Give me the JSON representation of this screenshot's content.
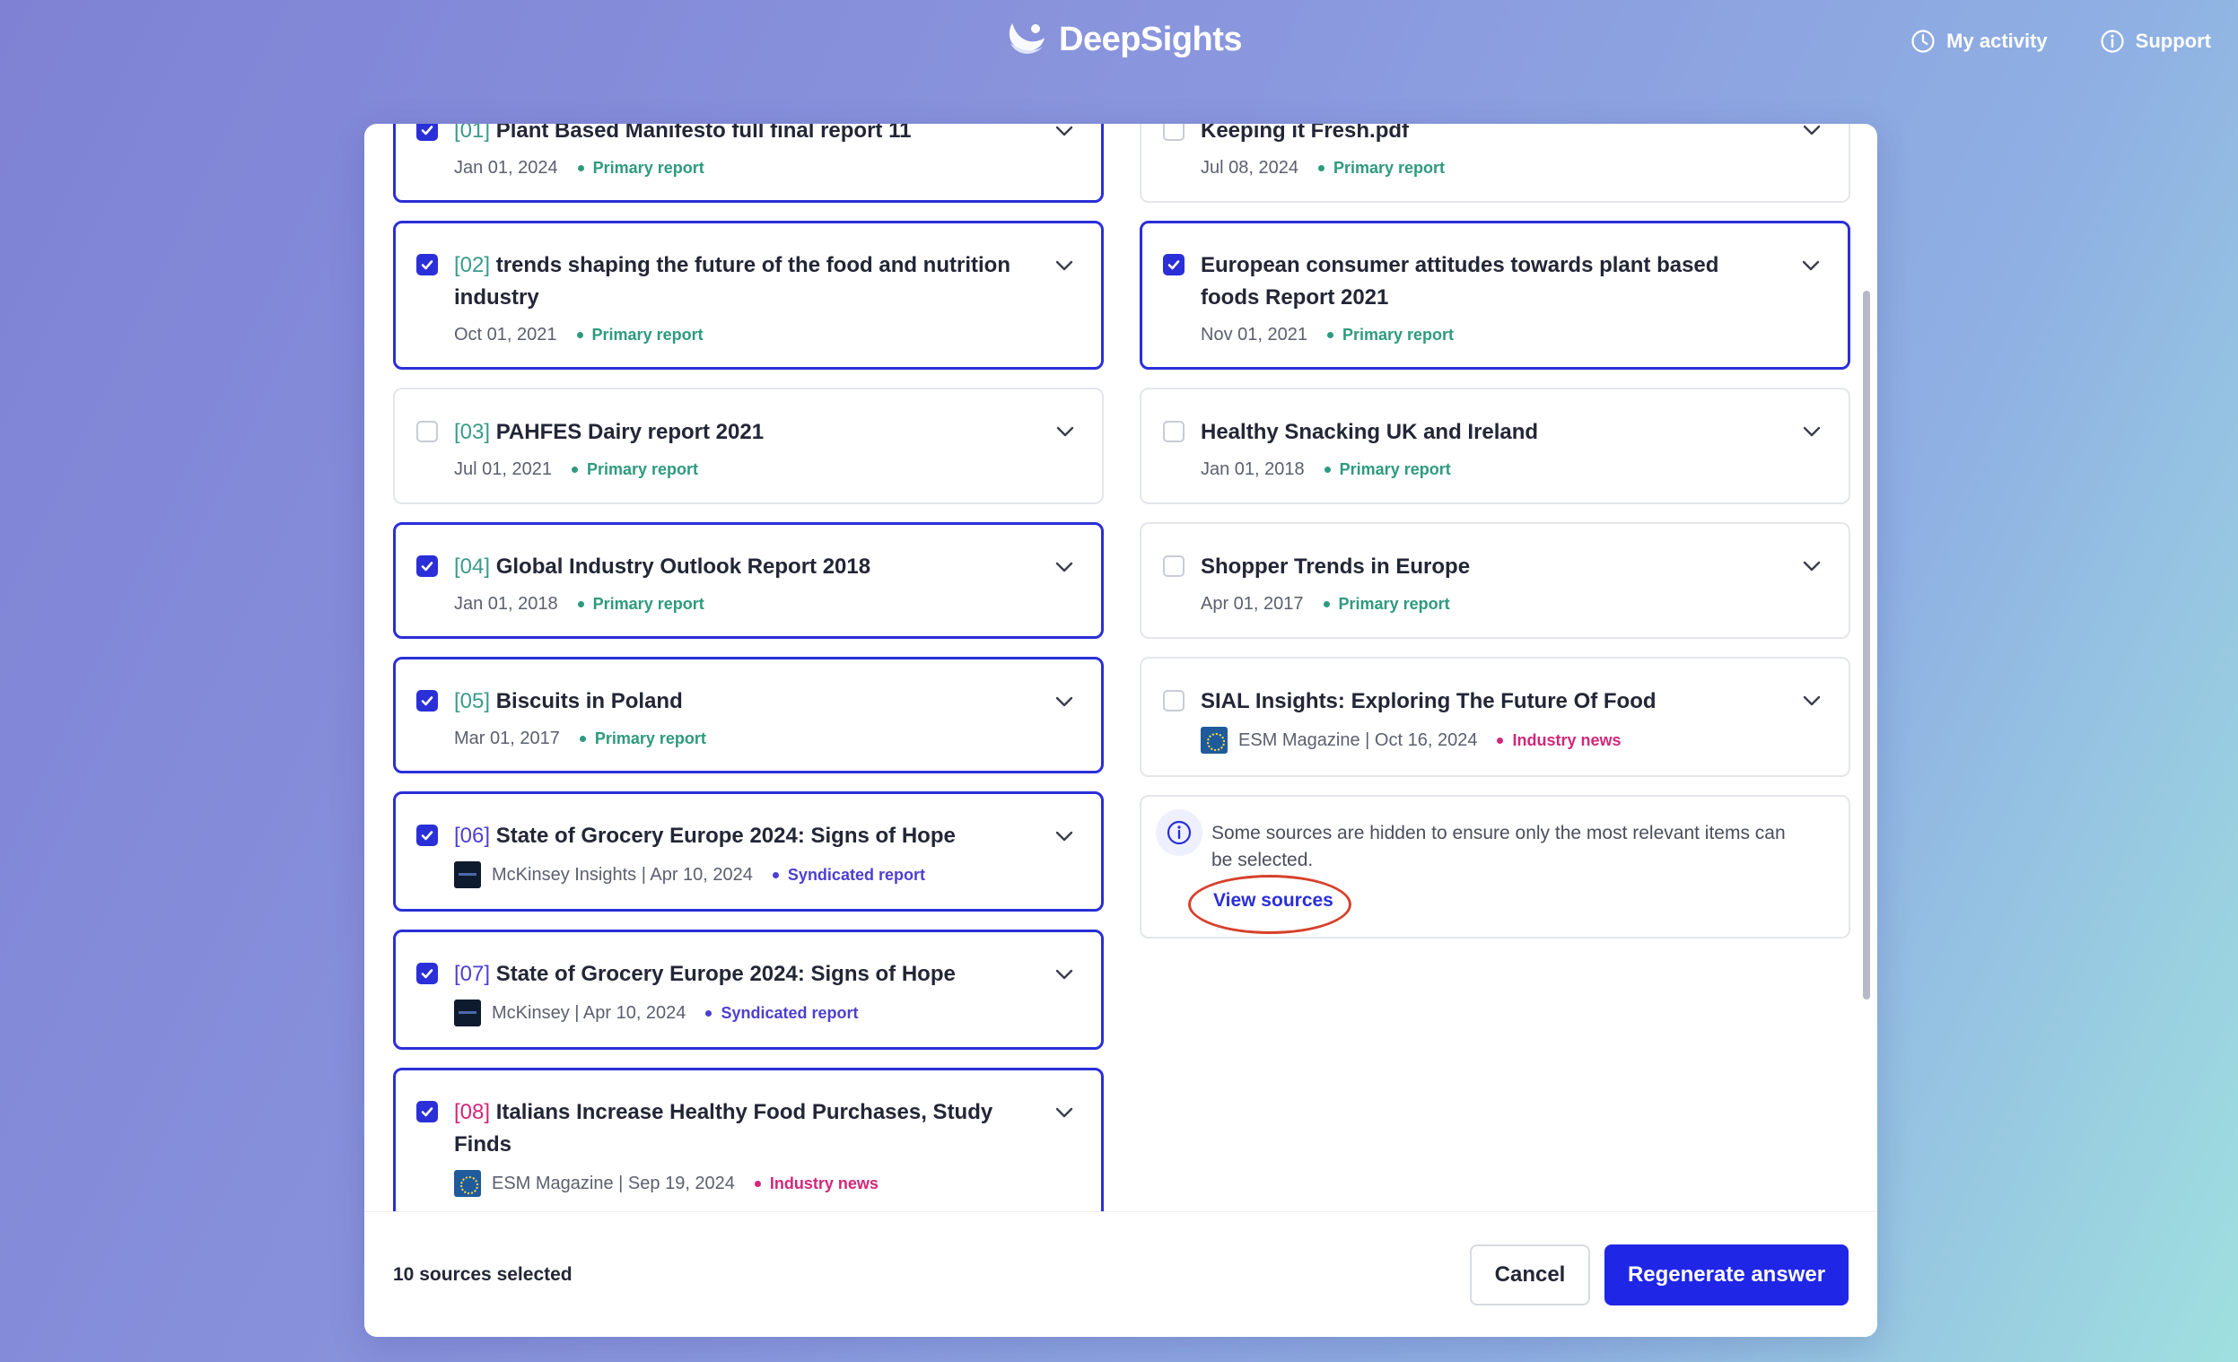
{
  "app": {
    "name": "DeepSights"
  },
  "topnav": {
    "activity": "My activity",
    "support": "Support"
  },
  "left_cards": [
    {
      "num": "[01]",
      "title": "Plant Based Manifesto full final report 11",
      "date": "Jan 01, 2024",
      "tag": "Primary report"
    },
    {
      "num": "[02]",
      "title": "trends shaping the future of the food and nutrition industry",
      "date": "Oct 01, 2021",
      "tag": "Primary report"
    },
    {
      "num": "[03]",
      "title": "PAHFES Dairy report 2021",
      "date": "Jul 01, 2021",
      "tag": "Primary report"
    },
    {
      "num": "[04]",
      "title": "Global Industry Outlook Report 2018",
      "date": "Jan 01, 2018",
      "tag": "Primary report"
    },
    {
      "num": "[05]",
      "title": "Biscuits in Poland",
      "date": "Mar 01, 2017",
      "tag": "Primary report"
    },
    {
      "num": "[06]",
      "title": "State of Grocery Europe 2024: Signs of Hope",
      "date": "McKinsey Insights | Apr 10, 2024",
      "tag": "Syndicated report"
    },
    {
      "num": "[07]",
      "title": "State of Grocery Europe 2024: Signs of Hope",
      "date": "McKinsey | Apr 10, 2024",
      "tag": "Syndicated report"
    },
    {
      "num": "[08]",
      "title": "Italians Increase Healthy Food Purchases, Study Finds",
      "date": "ESM Magazine | Sep 19, 2024",
      "tag": "Industry news"
    }
  ],
  "right_cards": [
    {
      "title": "Keeping it Fresh.pdf",
      "date": "Jul 08, 2024",
      "tag": "Primary report"
    },
    {
      "title": "European consumer attitudes towards plant based foods Report 2021",
      "date": "Nov 01, 2021",
      "tag": "Primary report"
    },
    {
      "title": "Healthy Snacking UK and Ireland",
      "date": "Jan 01, 2018",
      "tag": "Primary report"
    },
    {
      "title": "Shopper Trends in Europe",
      "date": "Apr 01, 2017",
      "tag": "Primary report"
    },
    {
      "title": "SIAL Insights: Exploring The Future Of Food",
      "date": "ESM Magazine | Oct 16, 2024",
      "tag": "Industry news"
    }
  ],
  "info": {
    "text": "Some sources are hidden to ensure only the most relevant items can be selected.",
    "link": "View sources"
  },
  "footer": {
    "count": "10 sources selected",
    "cancel": "Cancel",
    "regenerate": "Regenerate answer"
  },
  "colors": {
    "accent": "#2a2fd8",
    "primary_tag": "#2e9a7e",
    "syndicated_tag": "#4d3fd0",
    "news_tag": "#d2277a",
    "highlight_ring": "#d7412c"
  }
}
